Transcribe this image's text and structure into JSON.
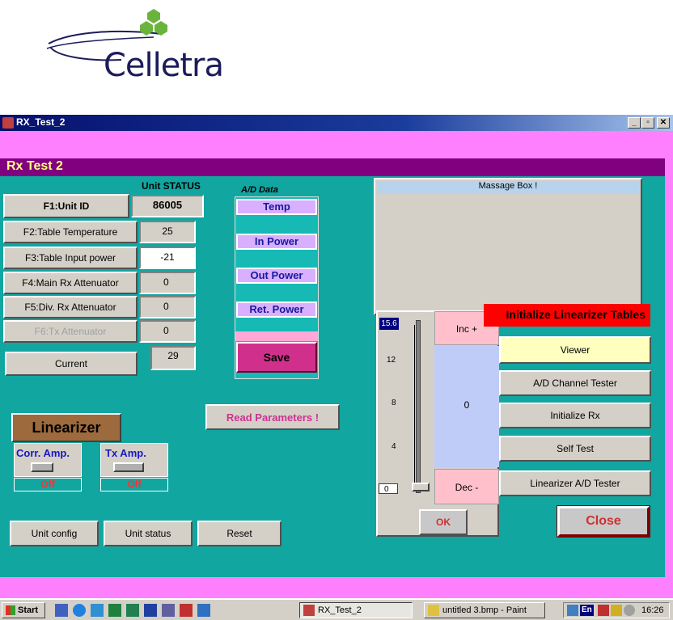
{
  "logo": {
    "text": "Celletra"
  },
  "window": {
    "title": "RX_Test_2",
    "min": "_",
    "max": "▫",
    "close": "✕"
  },
  "header": {
    "title": "Rx Test 2"
  },
  "unit_status": {
    "heading": "Unit STATUS",
    "rows": [
      {
        "label": "F1:Unit ID",
        "value": "86005"
      },
      {
        "label": "F2:Table Temperature",
        "value": "25"
      },
      {
        "label": "F3:Table Input power",
        "value": "-21"
      },
      {
        "label": "F4:Main Rx Attenuator",
        "value": "0"
      },
      {
        "label": "F5:Div. Rx Attenuator",
        "value": "0"
      },
      {
        "label": "F6:Tx Attenuator",
        "value": "0"
      },
      {
        "label": "Current",
        "value": "29"
      }
    ]
  },
  "ad_data": {
    "heading": "A/D Data",
    "labels": [
      "Temp",
      "In Power",
      "Out Power",
      "Ret. Power"
    ],
    "save": "Save"
  },
  "read_params": "Read  Parameters !",
  "linearizer": {
    "title": "Linearizer",
    "corr": {
      "label": "Corr. Amp.",
      "state": "Off"
    },
    "tx": {
      "label": "Tx  Amp.",
      "state": "Off"
    }
  },
  "bottom_buttons": [
    "Unit config",
    "Unit status",
    "Reset"
  ],
  "message_box": {
    "title": "Massage Box !"
  },
  "slider": {
    "top_value": "15.6",
    "ticks": [
      "12",
      "8",
      "4"
    ],
    "bottom_value": "0",
    "inc": "Inc +",
    "dec": "Dec -",
    "display": "0",
    "ok": "OK",
    "level": 0
  },
  "right_buttons": {
    "init_tables": "Initialize Linearizer Tables",
    "viewer": "Viewer",
    "ad_tester": "A/D Channel Tester",
    "init_rx": "Initialize Rx",
    "self_test": "Self Test",
    "lin_tester": "Linearizer A/D  Tester",
    "close": "Close"
  },
  "taskbar": {
    "start": "Start",
    "tasks": [
      "RX_Test_2",
      "untitled 3.bmp - Paint"
    ],
    "lang": "En",
    "clock": "16:26"
  },
  "colors": {
    "teal": "#12a6a1",
    "pink": "#ff80ff",
    "purple": "#800080",
    "red": "#ff0000"
  }
}
